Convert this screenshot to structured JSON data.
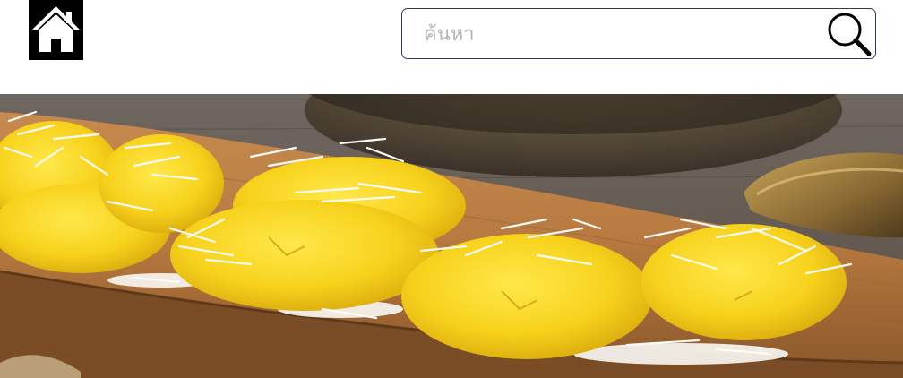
{
  "header": {
    "home_icon": "home-icon",
    "search": {
      "placeholder": "ค้นหา",
      "value": "",
      "icon": "search-icon"
    }
  },
  "hero": {
    "subject": "steamed-yellow-cakes-with-coconut-image"
  },
  "colors": {
    "home_bg": "#000000",
    "search_border": "#2d3a5a",
    "placeholder": "#b5b5b5"
  }
}
